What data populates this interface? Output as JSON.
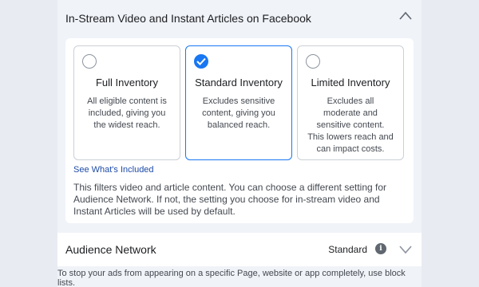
{
  "section": {
    "title": "In-Stream Video and Instant Articles on Facebook"
  },
  "options": [
    {
      "title": "Full Inventory",
      "description": "All eligible content is included, giving you the widest reach.",
      "selected": false
    },
    {
      "title": "Standard Inventory",
      "description": "Excludes sensitive content, giving you balanced reach.",
      "selected": true
    },
    {
      "title": "Limited Inventory",
      "description": "Excludes all moderate and sensitive content. This lowers reach and can impact costs.",
      "selected": false
    }
  ],
  "link_label": "See What's Included",
  "help_text": "This filters video and article content. You can choose a different setting for Audience Network. If not, the setting you choose for in-stream video and Instant Articles will be used by default.",
  "audience_network": {
    "label": "Audience Network",
    "value": "Standard"
  },
  "footer_text": "To stop your ads from appearing on a specific Page, website or app completely, use block lists.",
  "colors": {
    "accent": "#1877f2",
    "link": "#1d4ba8",
    "panel_background": "#f0f3f8"
  }
}
